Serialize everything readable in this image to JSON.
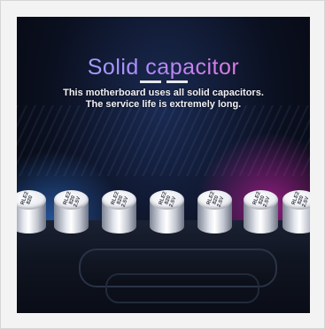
{
  "hero": {
    "title": "Solid capacitor",
    "subtitle_line1": "This motherboard uses all solid capacitors.",
    "subtitle_line2": "The service life is extremely long."
  },
  "capacitors": [
    {
      "label": "RLE2\n820"
    },
    {
      "label": "RLE2\n820\n2.5V"
    },
    {
      "label": "RLE2\n820\n2.5V"
    },
    {
      "label": "RLE2\n820\n2.5V"
    },
    {
      "label": "RLE2\n820\n2.5V"
    },
    {
      "label": "RLE2\n820\n2.5V"
    },
    {
      "label": "RLE2\n820\n2.5V"
    }
  ],
  "colors": {
    "title_gradient_start": "#8fb2ff",
    "title_gradient_end": "#ff6ac8",
    "glow_blue": "#3c8cff",
    "glow_magenta": "#e628be"
  }
}
